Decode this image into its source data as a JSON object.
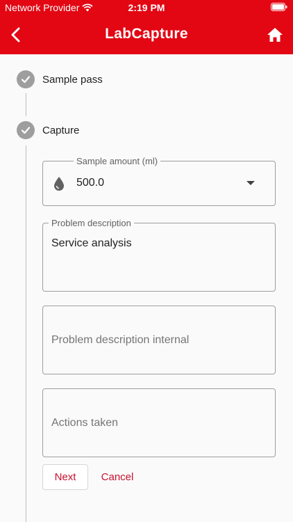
{
  "status_bar": {
    "carrier": "Network Provider",
    "time": "2:19 PM"
  },
  "app_bar": {
    "title": "LabCapture"
  },
  "steps": [
    {
      "label": "Sample pass"
    },
    {
      "label": "Capture"
    }
  ],
  "form": {
    "sample_amount": {
      "label": "Sample amount (ml)",
      "value": "500.0"
    },
    "problem_description": {
      "label": "Problem description",
      "value": "Service analysis"
    },
    "problem_description_internal": {
      "placeholder": "Problem description internal"
    },
    "actions_taken": {
      "placeholder": "Actions taken"
    }
  },
  "buttons": {
    "next": "Next",
    "cancel": "Cancel"
  },
  "colors": {
    "brand": "#e30613",
    "accent_text": "#c8102e",
    "step_icon": "#9e9e9e"
  }
}
